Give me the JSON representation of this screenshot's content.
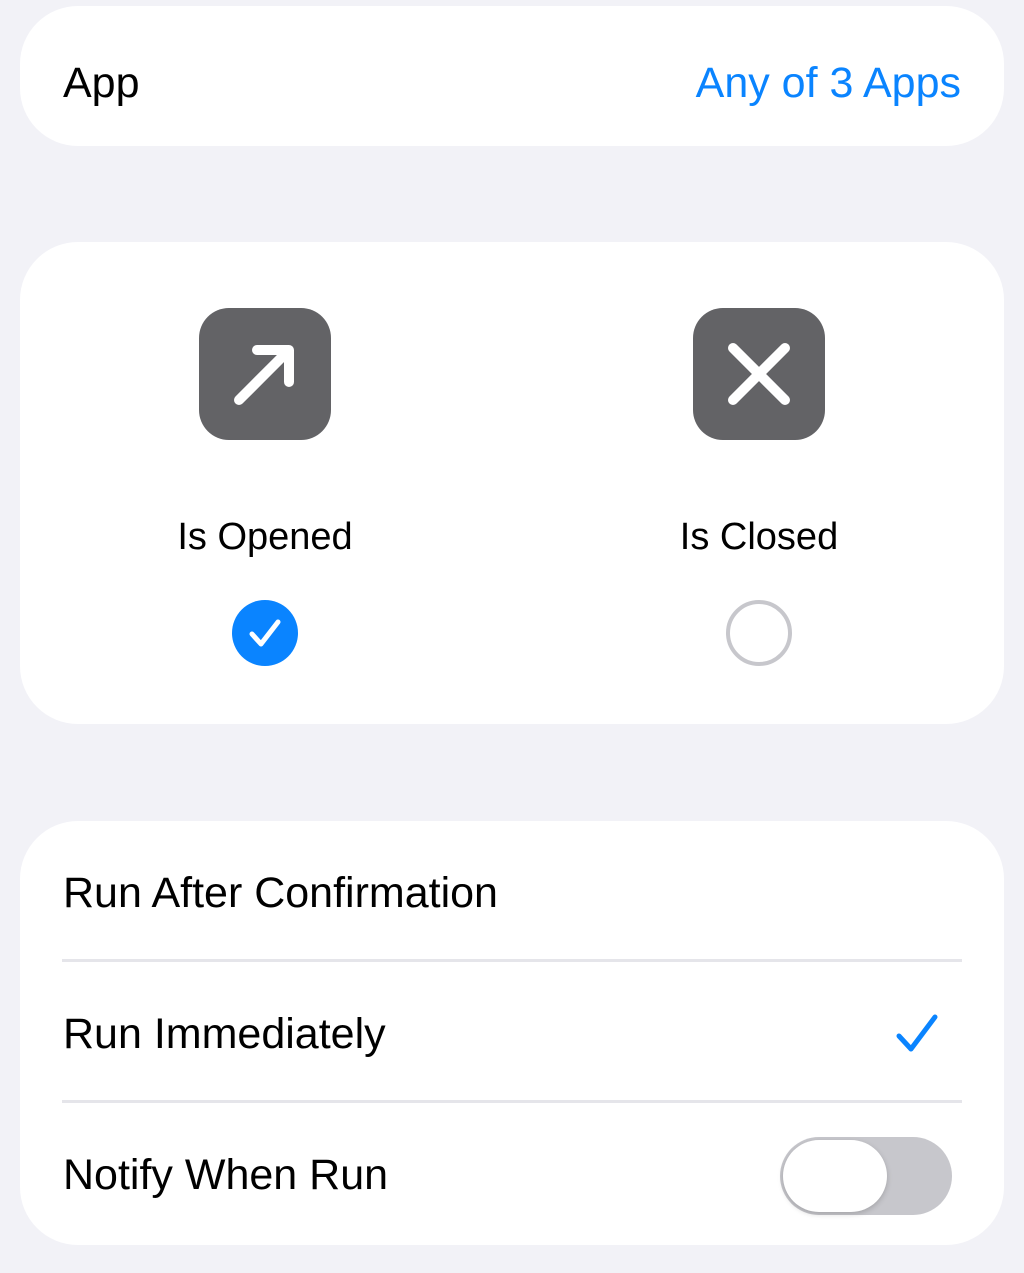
{
  "app_row": {
    "label": "App",
    "value": "Any of 3 Apps"
  },
  "trigger": {
    "options": [
      {
        "label": "Is Opened",
        "icon": "arrow-up-right-icon",
        "selected": true
      },
      {
        "label": "Is Closed",
        "icon": "xmark-icon",
        "selected": false
      }
    ]
  },
  "run_options": {
    "items": [
      {
        "label": "Run After Confirmation",
        "selected": false
      },
      {
        "label": "Run Immediately",
        "selected": true
      }
    ],
    "notify": {
      "label": "Notify When Run",
      "enabled": false
    }
  },
  "colors": {
    "accent": "#0a84ff",
    "icon_tile": "#636366",
    "background": "#f2f2f7",
    "toggle_off": "#c7c7cc"
  }
}
